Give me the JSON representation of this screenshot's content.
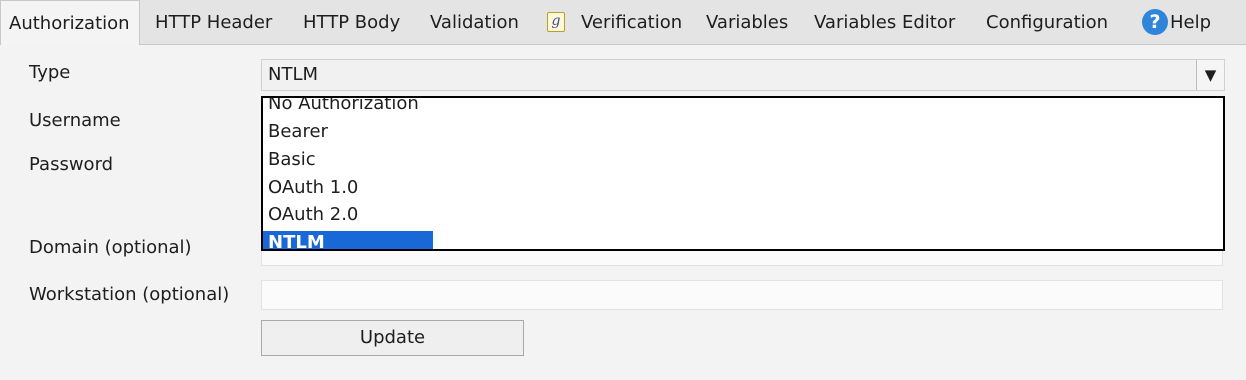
{
  "tabs": [
    {
      "label": "Authorization",
      "active": true
    },
    {
      "label": "HTTP Header"
    },
    {
      "label": "HTTP Body"
    },
    {
      "label": "Validation"
    },
    {
      "label": "Verification",
      "icon": "verification-script-icon"
    },
    {
      "label": "Variables"
    },
    {
      "label": "Variables Editor"
    },
    {
      "label": "Configuration"
    }
  ],
  "help": {
    "label": "Help",
    "icon": "help-icon"
  },
  "verification_icon_glyph": "g",
  "help_icon_glyph": "?",
  "form": {
    "type_label": "Type",
    "type_value": "NTLM",
    "dropdown_arrow": "▼",
    "username_label": "Username",
    "password_label": "Password",
    "domain_label": "Domain (optional)",
    "workstation_label": "Workstation (optional)",
    "options": [
      "No Authorization",
      "Bearer",
      "Basic",
      "OAuth 1.0",
      "OAuth 2.0",
      "NTLM"
    ],
    "selected_option": "NTLM",
    "update_button": "Update"
  },
  "colors": {
    "selection": "#1868d8",
    "help_icon": "#2f86d8",
    "panel_background": "#f3f3f3"
  }
}
